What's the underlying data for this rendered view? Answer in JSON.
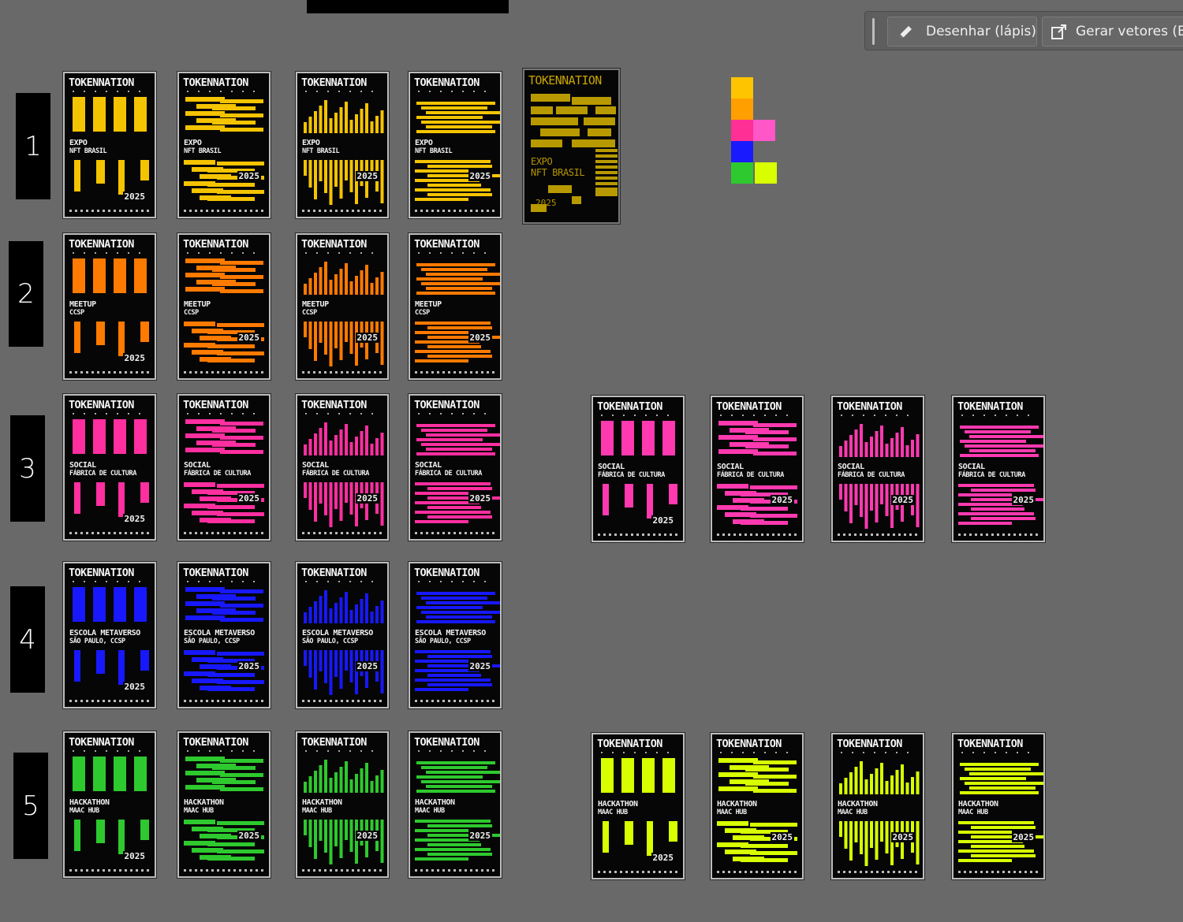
{
  "toolbar": {
    "draw_label": "Desenhar (lápis)",
    "vectors_label": "Gerar vetores (Bet",
    "draw_icon": "pencil-icon",
    "vectors_icon": "export-vector-icon"
  },
  "brand_title": "TOKENNATION",
  "year": "2025",
  "rows": [
    {
      "label": "1",
      "color": "#f5c400",
      "line1": "EXPO",
      "line2": "NFT BRASIL"
    },
    {
      "label": "2",
      "color": "#ff7a00",
      "line1": "MEETUP",
      "line2": "CCSP"
    },
    {
      "label": "3",
      "color": "#ff2fa0",
      "line1": "SOCIAL",
      "line2": "FÁBRICA DE CULTURA"
    },
    {
      "label": "4",
      "color": "#1818ff",
      "line1": "ESCOLA METAVERSO",
      "line2": "SÃO PAULO, CCSP"
    },
    {
      "label": "5",
      "color": "#2ec92e",
      "line1": "HACKATHON",
      "line2": "MAAC HUB"
    }
  ],
  "alt_rows": [
    {
      "color": "#ff3ab0",
      "line1": "SOCIAL",
      "line2": "FÁBRICA DE CULTURA"
    },
    {
      "color": "#d8ff00",
      "line1": "HACKATHON",
      "line2": "MAAC HUB"
    }
  ],
  "featured_poster": {
    "color": "#b89a00",
    "line1": "EXPO",
    "line2": "NFT BRASIL",
    "year": "2025"
  },
  "palette": [
    "#ffc400",
    "#ff9f00",
    "#ff2f95",
    "#ff56c8",
    "#1a1aff",
    "#2ec92e",
    "#d8ff00"
  ]
}
